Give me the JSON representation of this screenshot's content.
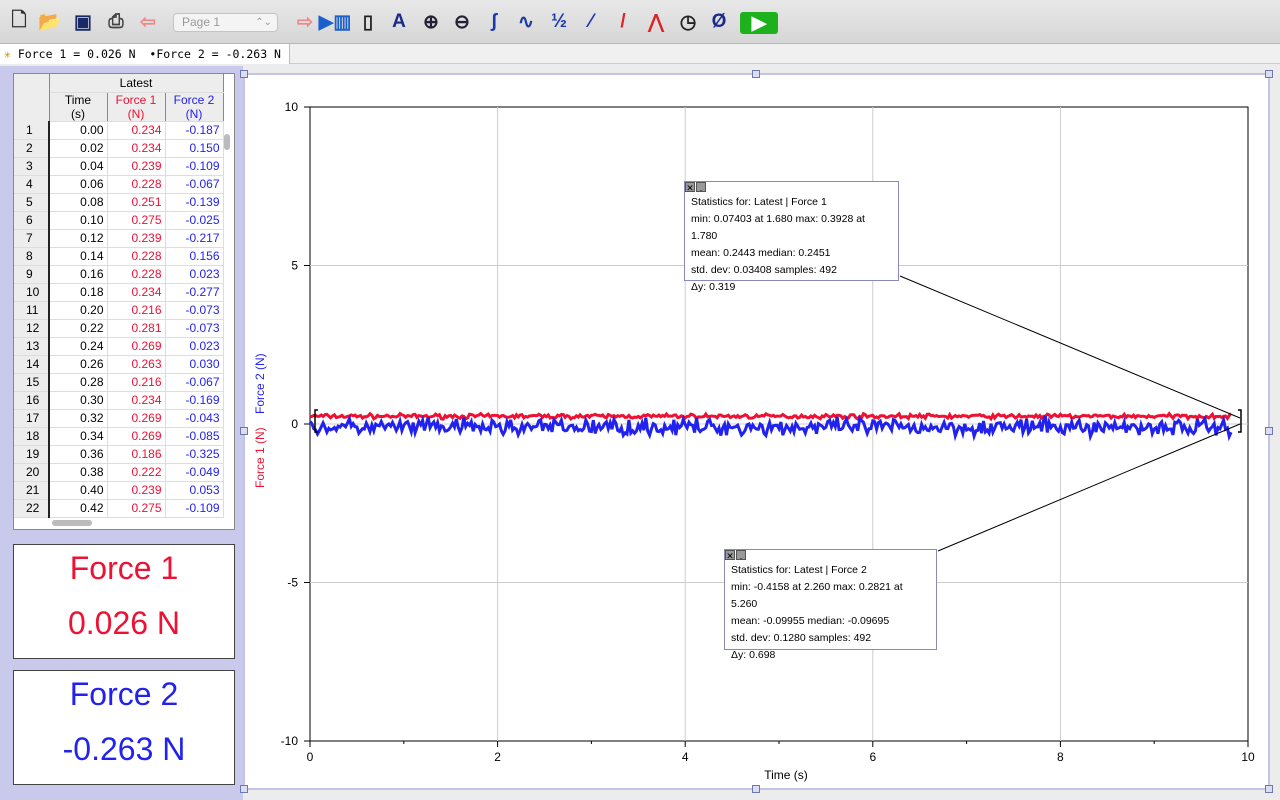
{
  "toolbar": {
    "icons": [
      "new-file",
      "open-folder",
      "save",
      "print",
      "back-page",
      "forward-page",
      "data-browser",
      "lab-interface",
      "autoscale",
      "zoom-in",
      "zoom-out",
      "examine",
      "interpolate",
      "integral",
      "tangent",
      "linear-fit",
      "curve-fit",
      "statistics-timer",
      "zero",
      "collect"
    ],
    "page_select": "Page 1"
  },
  "status": {
    "text": "Force 1 = 0.026 N  •Force 2 = -0.263 N"
  },
  "table": {
    "group": "Latest",
    "columns": [
      {
        "name": "Time",
        "unit": "(s)"
      },
      {
        "name": "Force 1",
        "unit": "(N)"
      },
      {
        "name": "Force 2",
        "unit": "(N)"
      }
    ],
    "rows": [
      [
        "1",
        "0.00",
        "0.234",
        "-0.187"
      ],
      [
        "2",
        "0.02",
        "0.234",
        "0.150"
      ],
      [
        "3",
        "0.04",
        "0.239",
        "-0.109"
      ],
      [
        "4",
        "0.06",
        "0.228",
        "-0.067"
      ],
      [
        "5",
        "0.08",
        "0.251",
        "-0.139"
      ],
      [
        "6",
        "0.10",
        "0.275",
        "-0.025"
      ],
      [
        "7",
        "0.12",
        "0.239",
        "-0.217"
      ],
      [
        "8",
        "0.14",
        "0.228",
        "0.156"
      ],
      [
        "9",
        "0.16",
        "0.228",
        "0.023"
      ],
      [
        "10",
        "0.18",
        "0.234",
        "-0.277"
      ],
      [
        "11",
        "0.20",
        "0.216",
        "-0.073"
      ],
      [
        "12",
        "0.22",
        "0.281",
        "-0.073"
      ],
      [
        "13",
        "0.24",
        "0.269",
        "0.023"
      ],
      [
        "14",
        "0.26",
        "0.263",
        "0.030"
      ],
      [
        "15",
        "0.28",
        "0.216",
        "-0.067"
      ],
      [
        "16",
        "0.30",
        "0.234",
        "-0.169"
      ],
      [
        "17",
        "0.32",
        "0.269",
        "-0.043"
      ],
      [
        "18",
        "0.34",
        "0.269",
        "-0.085"
      ],
      [
        "19",
        "0.36",
        "0.186",
        "-0.325"
      ],
      [
        "20",
        "0.38",
        "0.222",
        "-0.049"
      ],
      [
        "21",
        "0.40",
        "0.239",
        "0.053"
      ],
      [
        "22",
        "0.42",
        "0.275",
        "-0.109"
      ]
    ]
  },
  "meters": [
    {
      "label": "Force 1",
      "value": "0.026 N",
      "color": "#ee1133"
    },
    {
      "label": "Force 2",
      "value": "-0.263 N",
      "color": "#2222ee"
    }
  ],
  "stats": [
    {
      "lines": [
        "Statistics for: Latest | Force 1",
        "min: 0.07403 at 1.680 max: 0.3928 at 1.780",
        "mean: 0.2443 median: 0.2451",
        "std. dev: 0.03408 samples: 492",
        "Δy: 0.319"
      ]
    },
    {
      "lines": [
        "Statistics for: Latest | Force 2",
        "min: -0.4158 at 2.260 max: 0.2821 at 5.260",
        "mean: -0.09955 median: -0.09695",
        "std. dev: 0.1280 samples: 492",
        "Δy: 0.698"
      ]
    }
  ],
  "chart_data": {
    "type": "line",
    "xlabel": "Time (s)",
    "ylabels": [
      "Force 1 (N)",
      "Force 2 (N)"
    ],
    "xlim": [
      0,
      10
    ],
    "ylim": [
      -10,
      10
    ],
    "xticks": [
      "0",
      "2",
      "4",
      "6",
      "8",
      "10"
    ],
    "yticks": [
      "10",
      "5",
      "0",
      "-5",
      "-10"
    ],
    "grid": true,
    "series": [
      {
        "name": "Force 1",
        "color": "#ee1133",
        "mean": 0.2443,
        "std": 0.03408,
        "samples": 492,
        "x_range": [
          0,
          9.82
        ]
      },
      {
        "name": "Force 2",
        "color": "#2222ee",
        "mean": -0.09955,
        "std": 0.128,
        "samples": 492,
        "x_range": [
          0,
          9.82
        ]
      }
    ]
  }
}
